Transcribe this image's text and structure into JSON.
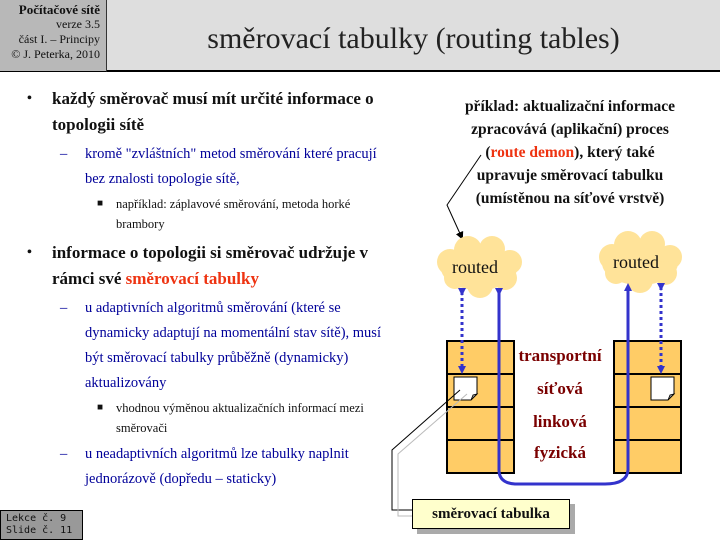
{
  "header": {
    "course": "Počítačové sítě",
    "version": "verze 3.5",
    "part": "část I.  – Principy",
    "copyright": "© J. Peterka, 2010",
    "title": "směrovací tabulky (routing tables)"
  },
  "content": {
    "items": [
      {
        "level": 1,
        "text": "každý směrovač musí mít určité informace o topologii sítě"
      },
      {
        "level": 2,
        "text": "kromě \"zvláštních\" metod směrování které pracují bez znalosti topologie sítě,"
      },
      {
        "level": 3,
        "text": "například: záplavové směrování, metoda horké brambory"
      },
      {
        "level": 1,
        "text_before": "informace o topologii si směrovač udržuje v rámci své ",
        "highlight": "směrovací tabulky"
      },
      {
        "level": 2,
        "text": "u adaptivních algoritmů směrování (které se dynamicky adaptují na momentální stav sítě), musí být směrovací tabulky průběžně (dynamicky) aktualizovány"
      },
      {
        "level": 3,
        "text": "vhodnou výměnou aktualizačních informací mezi směrovači"
      },
      {
        "level": 2,
        "text": "u neadaptivních algoritmů lze tabulky naplnit jednorázově (dopředu – staticky)"
      }
    ]
  },
  "callout": {
    "line1": "příklad: aktualizační informace",
    "line2": "zpracovává (aplikační) proces",
    "open_paren": "(",
    "highlight": "route demon",
    "line3_rest": "), který také",
    "line4": "upravuje směrovací tabulku",
    "line5": "(umístěnou na síťové vrstvě)"
  },
  "diagram": {
    "cloud_left": "routed",
    "cloud_right": "routed",
    "layers": [
      "transportní",
      "síťová",
      "linková",
      "fyzická"
    ],
    "routing_table_label": "směrovací tabulka"
  },
  "footer": {
    "lesson": "Lekce č. 9",
    "slide": "Slide č. 11"
  },
  "colors": {
    "header_left_bg": "#b8b8b8",
    "header_right_bg": "#dedede",
    "level2_text": "#000099",
    "highlight_red": "#ee3311",
    "layer_fill": "#ffcc66",
    "cloud_fill": "#ffe399",
    "arrow_blue": "#3333cc",
    "layer_label": "#7a0000"
  }
}
